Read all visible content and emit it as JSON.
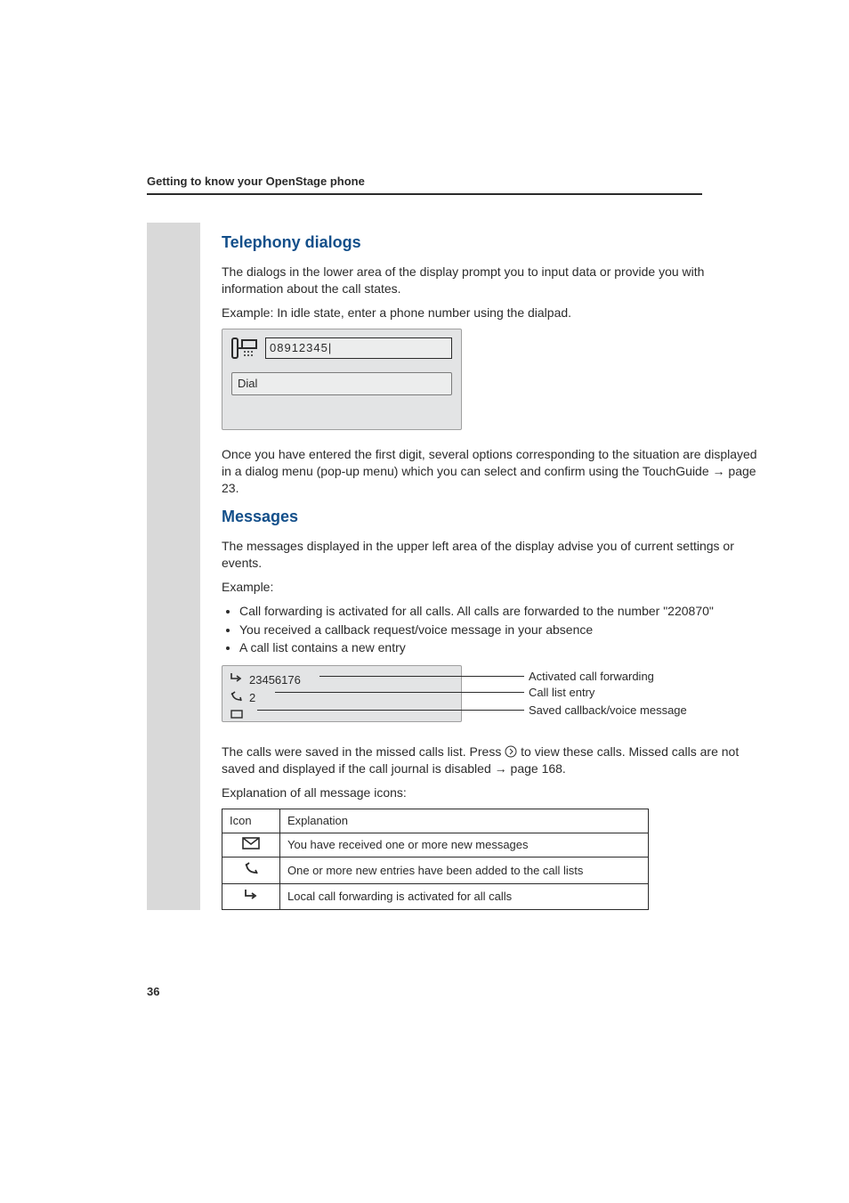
{
  "running_head": "Getting to know your OpenStage phone",
  "section1": {
    "title": "Telephony dialogs",
    "p1": "The dialogs in the lower area of the display prompt you to input data or provide you with information about the call states.",
    "p2": "Example: In idle state, enter a phone number using the dialpad.",
    "number": "08912345|",
    "action": "Dial",
    "p3_a": "Once you have entered the first digit, several options corresponding to the situation are displayed in a dialog menu (pop-up menu) which you can select and confirm using the TouchGuide ",
    "p3_arrow": "→",
    "p3_b": " page 23."
  },
  "section2": {
    "title": "Messages",
    "p1": "The messages displayed in the upper left area of the display advise you of current settings or events.",
    "example_label": "Example:",
    "bullets": [
      "Call forwarding is activated for all calls. All calls are forwarded to the number \"220870\"",
      "You received a callback request/voice message in your absence",
      "A call list contains a new entry"
    ],
    "msgbox": {
      "line1_text": "23456176",
      "line2_text": "2"
    },
    "callouts": {
      "c1": "Activated call forwarding",
      "c2": "Call list entry",
      "c3": "Saved callback/voice message"
    },
    "p2_a": "The calls were saved in the missed calls list. Press ",
    "p2_b": " to view these calls. Missed calls are not saved and displayed if the call journal is disabled ",
    "p2_arrow": "→",
    "p2_c": " page 168.",
    "p3": "Explanation of all message icons:",
    "table": {
      "h1": "Icon",
      "h2": "Explanation",
      "rows": [
        {
          "icon": "envelope",
          "text": "You have received one or more new messages"
        },
        {
          "icon": "calllist",
          "text": "One or more new entries have been added to the call lists"
        },
        {
          "icon": "forward",
          "text": "Local call forwarding is activated for all calls"
        }
      ]
    }
  },
  "page_number": "36"
}
